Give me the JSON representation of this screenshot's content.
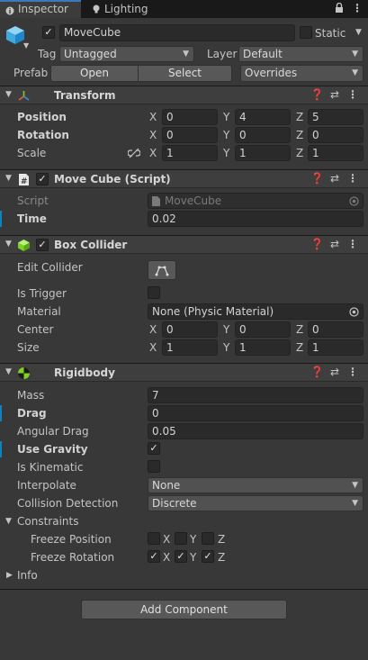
{
  "tabs": [
    {
      "label": "Inspector",
      "icon": "info-icon"
    },
    {
      "label": "Lighting",
      "icon": "lightbulb-icon"
    }
  ],
  "gameobject": {
    "name": "MoveCube",
    "active": true,
    "static_label": "Static",
    "tag_label": "Tag",
    "tag_value": "Untagged",
    "layer_label": "Layer",
    "layer_value": "Default",
    "prefab_label": "Prefab",
    "open_label": "Open",
    "select_label": "Select",
    "overrides_label": "Overrides"
  },
  "transform": {
    "title": "Transform",
    "position_label": "Position",
    "rotation_label": "Rotation",
    "scale_label": "Scale",
    "position": {
      "x": "0",
      "y": "4",
      "z": "5"
    },
    "rotation": {
      "x": "0",
      "y": "0",
      "z": "0"
    },
    "scale": {
      "x": "1",
      "y": "1",
      "z": "1"
    },
    "axis": {
      "x": "X",
      "y": "Y",
      "z": "Z"
    }
  },
  "move_cube": {
    "title": "Move Cube (Script)",
    "script_label": "Script",
    "script_value": "MoveCube",
    "time_label": "Time",
    "time_value": "0.02"
  },
  "box_collider": {
    "title": "Box Collider",
    "edit_collider_label": "Edit Collider",
    "is_trigger_label": "Is Trigger",
    "material_label": "Material",
    "material_value": "None (Physic Material)",
    "center_label": "Center",
    "size_label": "Size",
    "center": {
      "x": "0",
      "y": "0",
      "z": "0"
    },
    "size": {
      "x": "1",
      "y": "1",
      "z": "1"
    }
  },
  "rigidbody": {
    "title": "Rigidbody",
    "mass_label": "Mass",
    "mass_value": "7",
    "drag_label": "Drag",
    "drag_value": "0",
    "angular_drag_label": "Angular Drag",
    "angular_drag_value": "0.05",
    "use_gravity_label": "Use Gravity",
    "use_gravity": true,
    "is_kinematic_label": "Is Kinematic",
    "is_kinematic": false,
    "interpolate_label": "Interpolate",
    "interpolate_value": "None",
    "collision_detection_label": "Collision Detection",
    "collision_detection_value": "Discrete",
    "constraints_label": "Constraints",
    "freeze_position_label": "Freeze Position",
    "freeze_rotation_label": "Freeze Rotation",
    "info_label": "Info"
  },
  "add_component_label": "Add Component",
  "colors": {
    "background": "#383838",
    "accent": "#3a79bb",
    "modified_bar": "#0f81be"
  }
}
